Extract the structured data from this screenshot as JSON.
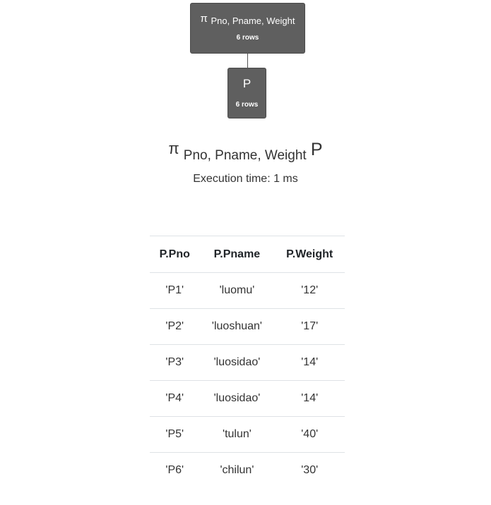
{
  "tree": {
    "root": {
      "op_symbol": "π",
      "op_params": "Pno, Pname, Weight",
      "rows": "6 rows"
    },
    "child": {
      "relation": "P",
      "rows": "6 rows"
    }
  },
  "expression": {
    "op_symbol": "π",
    "op_params": "Pno, Pname, Weight",
    "relation": "P",
    "execution_time": "Execution time: 1 ms"
  },
  "table": {
    "headers": [
      "P.Pno",
      "P.Pname",
      "P.Weight"
    ],
    "rows": [
      [
        "'P1'",
        "'luomu'",
        "'12'"
      ],
      [
        "'P2'",
        "'luoshuan'",
        "'17'"
      ],
      [
        "'P3'",
        "'luosidao'",
        "'14'"
      ],
      [
        "'P4'",
        "'luosidao'",
        "'14'"
      ],
      [
        "'P5'",
        "'tulun'",
        "'40'"
      ],
      [
        "'P6'",
        "'chilun'",
        "'30'"
      ]
    ]
  }
}
